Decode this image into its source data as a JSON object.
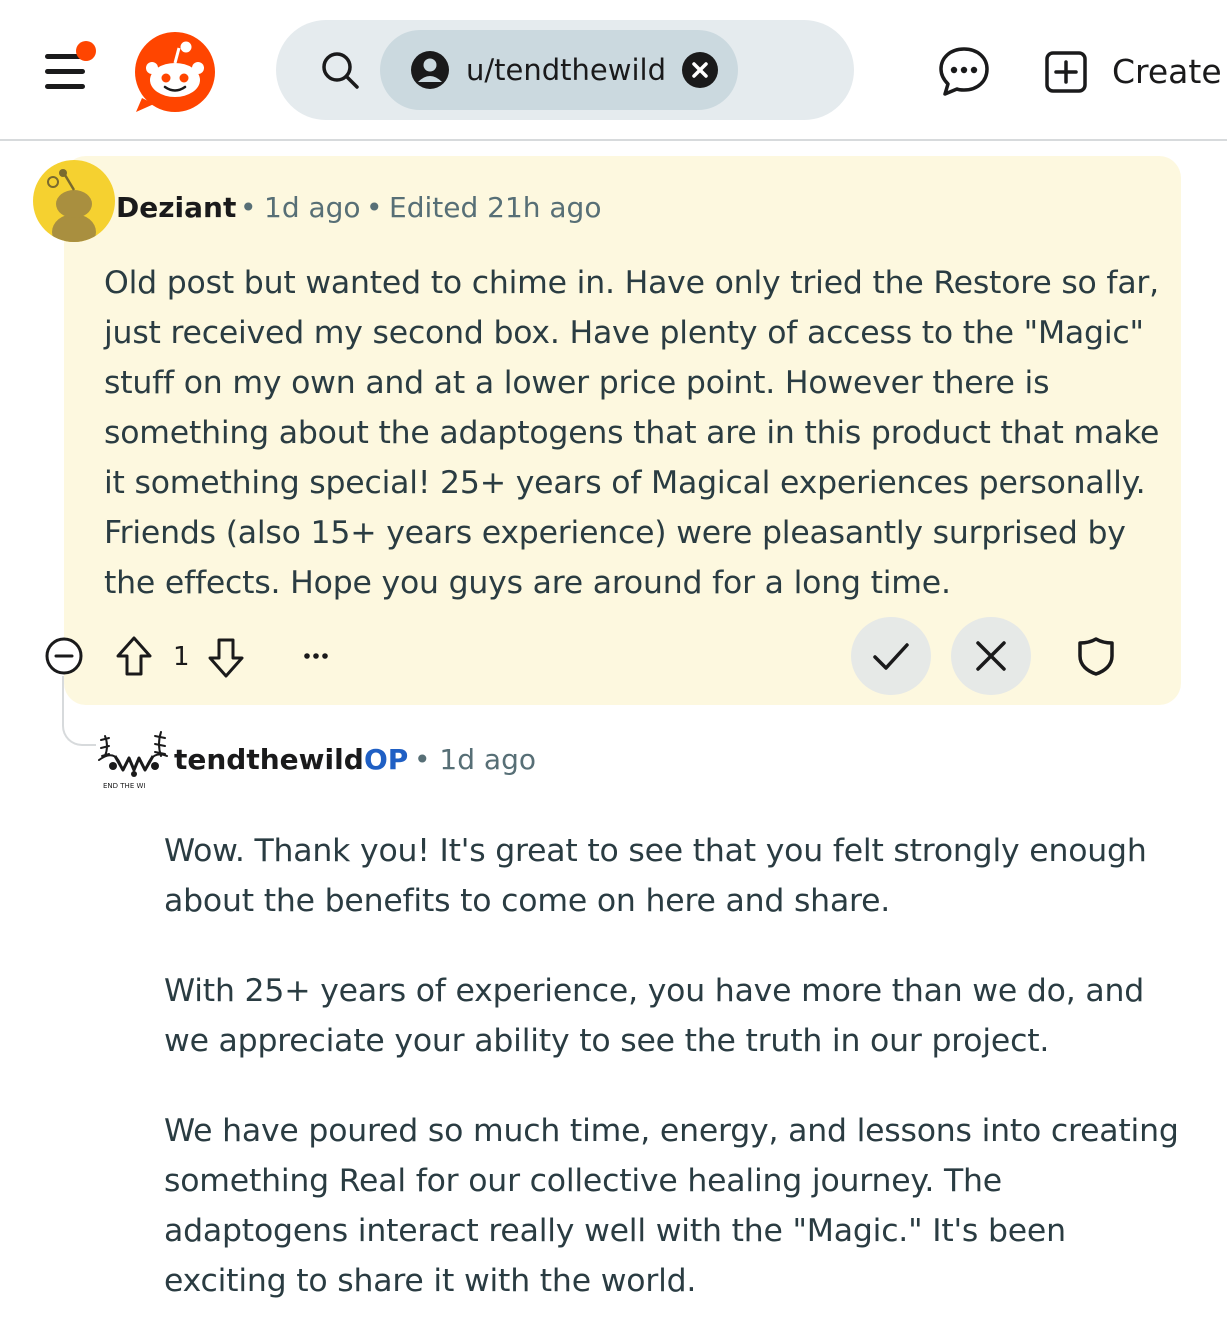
{
  "header": {
    "search_chip_label": "u/tendthewild",
    "create_label": "Create",
    "notification_dot_color": "#ff4500",
    "logo_color": "#ff4500"
  },
  "comment": {
    "author": "Deziant",
    "age": "1d ago",
    "edited": "Edited 21h ago",
    "body": "Old post but wanted to chime in. Have only tried the Restore so far, just received my second box. Have plenty of access to the \"Magic\" stuff on my own and at a lower price point. However there is something about the adaptogens that are in this product that make it something special! 25+ years of Magical experiences personally. Friends (also 15+ years experience) were pleasantly surprised by the effects. Hope you guys are around for a long time.",
    "vote_count": "1",
    "highlight_color": "#fdf8df"
  },
  "reply": {
    "author": "tendthewild",
    "op_badge": "OP",
    "age": "1d ago",
    "avatar_caption": "END THE WI",
    "paragraphs": [
      "Wow. Thank you! It's great to see that you felt strongly enough about the benefits to come on here and share.",
      "With 25+ years of experience, you have more than we do, and we appreciate your ability to see the truth in our project.",
      "We have poured so much time, energy, and lessons into creating something Real for our collective healing journey. The adaptogens interact really well with the \"Magic.\" It's been exciting to share it with the world."
    ]
  }
}
